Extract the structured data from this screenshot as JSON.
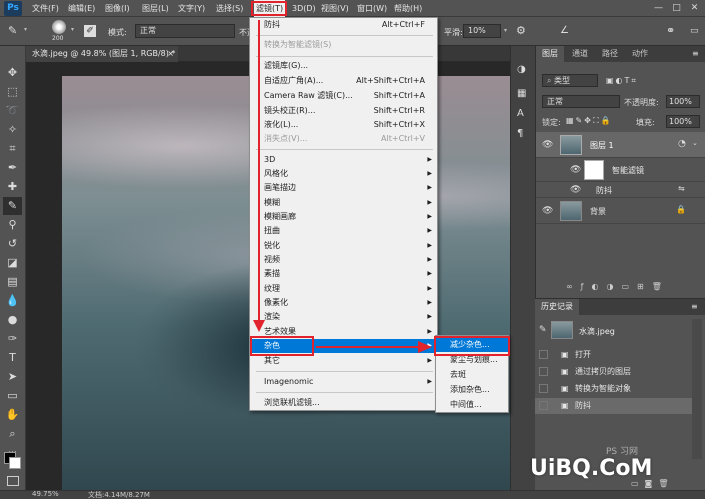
{
  "menubar": {
    "logo": "Ps",
    "items": [
      "文件(F)",
      "编辑(E)",
      "图像(I)",
      "图层(L)",
      "文字(Y)",
      "选择(S)",
      "滤镜(T)",
      "3D(D)",
      "视图(V)",
      "窗口(W)",
      "帮助(H)"
    ],
    "window_controls": {
      "min": "—",
      "max": "□",
      "close": "✕"
    }
  },
  "options": {
    "brush_size": "200",
    "mode_label": "模式:",
    "mode_value": "正常",
    "opacity_cut": "不透",
    "smooth_label": "平滑:",
    "smooth_value": "10%"
  },
  "document": {
    "tab_title": "水滴.jpeg @ 49.8% (图层 1, RGB/8) *",
    "tab_close": "×"
  },
  "status": {
    "zoom": "49.75%",
    "doc": "文档:4.14M/8.27M"
  },
  "layers_panel": {
    "tabs": [
      "图层",
      "通道",
      "路径",
      "动作"
    ],
    "filter_kind": "类型",
    "blend_mode": "正常",
    "opacity_label": "不透明度:",
    "opacity_value": "100%",
    "lock_label": "锁定:",
    "fill_label": "填充:",
    "fill_value": "100%",
    "layers": [
      {
        "name": "图层 1"
      },
      {
        "name": "智能滤镜"
      },
      {
        "name": "防抖"
      },
      {
        "name": "背景"
      }
    ]
  },
  "history_panel": {
    "title": "历史记录",
    "snapshot": "水滴.jpeg",
    "items": [
      "打开",
      "通过拷贝的图层",
      "转换为智能对象",
      "防抖"
    ]
  },
  "filter_menu": {
    "items": [
      {
        "label": "防抖",
        "shortcut": "Alt+Ctrl+F"
      },
      {
        "label": "转换为智能滤镜(S)",
        "disabled": true
      },
      {
        "label": "滤镜库(G)..."
      },
      {
        "label": "自适应广角(A)...",
        "shortcut": "Alt+Shift+Ctrl+A"
      },
      {
        "label": "Camera Raw 滤镜(C)...",
        "shortcut": "Shift+Ctrl+A"
      },
      {
        "label": "镜头校正(R)...",
        "shortcut": "Shift+Ctrl+R"
      },
      {
        "label": "液化(L)...",
        "shortcut": "Shift+Ctrl+X"
      },
      {
        "label": "消失点(V)...",
        "shortcut": "Alt+Ctrl+V",
        "disabled": true
      },
      {
        "label": "3D",
        "submenu": true
      },
      {
        "label": "风格化",
        "submenu": true
      },
      {
        "label": "画笔描边",
        "submenu": true
      },
      {
        "label": "模糊",
        "submenu": true
      },
      {
        "label": "模糊画廊",
        "submenu": true
      },
      {
        "label": "扭曲",
        "submenu": true
      },
      {
        "label": "锐化",
        "submenu": true
      },
      {
        "label": "视频",
        "submenu": true
      },
      {
        "label": "素描",
        "submenu": true
      },
      {
        "label": "纹理",
        "submenu": true
      },
      {
        "label": "像素化",
        "submenu": true
      },
      {
        "label": "渲染",
        "submenu": true
      },
      {
        "label": "艺术效果",
        "submenu": true
      },
      {
        "label": "杂色",
        "submenu": true,
        "highlighted": true
      },
      {
        "label": "其它",
        "submenu": true
      },
      {
        "label": "Imagenomic",
        "submenu": true
      },
      {
        "label": "浏览联机滤镜..."
      }
    ]
  },
  "noise_submenu": {
    "items": [
      "减少杂色...",
      "蒙尘与划痕...",
      "去斑",
      "添加杂色...",
      "中间值..."
    ]
  },
  "watermark": {
    "text": "UiBQ.CoM",
    "faint": "PS 习网"
  },
  "colors": {
    "menu_highlight": "#0078d7",
    "annotation_red": "#e0232d",
    "ui_panel": "#535353"
  }
}
